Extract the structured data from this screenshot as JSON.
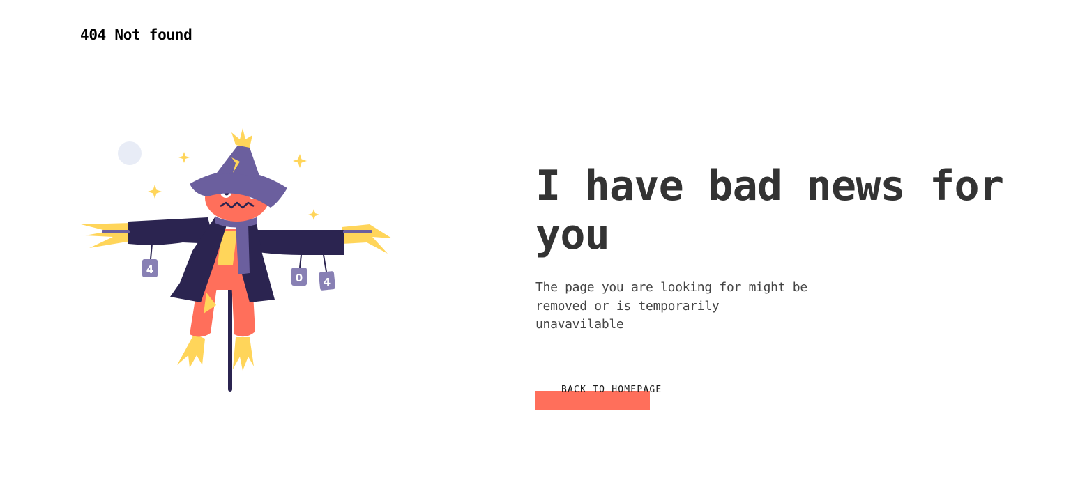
{
  "header": {
    "title": "404 Not found"
  },
  "illustration": {
    "can_labels": [
      "4",
      "0",
      "4"
    ],
    "colors": {
      "hat": "#6b5f9e",
      "coat": "#2b2450",
      "pumpkin": "#ff6f5b",
      "straw": "#ffd55a",
      "moon": "#e8ecf6"
    }
  },
  "main": {
    "heading": "I have bad news for you",
    "description": "The page you are looking for might be removed or is temporarily unavavilable",
    "button_label": "BACK TO HOMEPAGE"
  },
  "colors": {
    "accent": "#ff6f5b",
    "text": "#333333"
  }
}
